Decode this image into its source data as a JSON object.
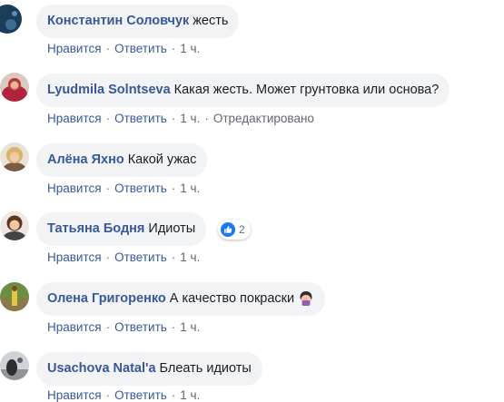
{
  "colors": {
    "link": "#385898",
    "meta": "#606770",
    "bubble": "#f2f3f5",
    "like": "#1877f2"
  },
  "labels": {
    "like": "Нравится",
    "reply": "Ответить",
    "separator": "·"
  },
  "comments": [
    {
      "author": "Константин Соловчук",
      "text": "жесть",
      "time": "1 ч.",
      "avatar": "avatar-partial"
    },
    {
      "author": "Lyudmila Solntseva",
      "text": "Какая жесть. Может грунтовка или основа?",
      "time": "1 ч.",
      "edited": "Отредактировано",
      "avatar": "avatar-red-hair"
    },
    {
      "author": "Алёна Яхно",
      "text": "Какой ужас",
      "time": "1 ч.",
      "avatar": "avatar-blonde"
    },
    {
      "author": "Татьяна Бодня",
      "text": "Идиоты",
      "time": "1 ч.",
      "reactions": {
        "icon": "like-icon",
        "count": "2"
      },
      "avatar": "avatar-brunette"
    },
    {
      "author": "Олена Григоренко",
      "text": "А качество покраски",
      "time": "1 ч.",
      "emoji": "woman-facepalming-emoji",
      "avatar": "avatar-outdoor"
    },
    {
      "author": "Usachova Natal'a",
      "text": "Блеать идиоты",
      "time": "1 ч.",
      "avatar": "avatar-gray"
    }
  ]
}
